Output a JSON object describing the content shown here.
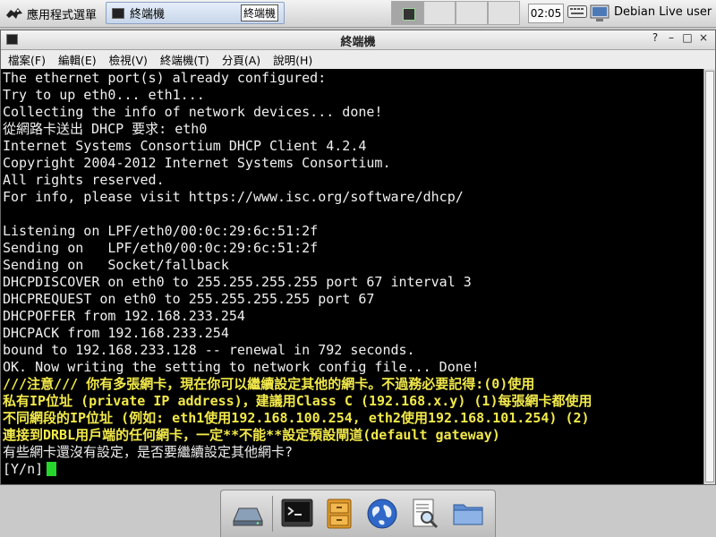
{
  "top_panel": {
    "app_menu_label": "應用程式選單",
    "task_title": "終端機",
    "task_title_right": "終端機",
    "clock": "02:05",
    "user": "Debian Live user"
  },
  "window": {
    "title": "終端機",
    "controls": {
      "help": "?",
      "minimize": "–",
      "maximize": "□",
      "close": "×"
    },
    "menu": [
      {
        "label": "檔案(F)"
      },
      {
        "label": "編輯(E)"
      },
      {
        "label": "檢視(V)"
      },
      {
        "label": "終端機(T)"
      },
      {
        "label": "分頁(A)"
      },
      {
        "label": "說明(H)"
      }
    ]
  },
  "terminal": {
    "lines": [
      {
        "text": "The ethernet port(s) already configured:",
        "style": "w"
      },
      {
        "text": "Try to up eth0... eth1...",
        "style": "w"
      },
      {
        "text": "Collecting the info of network devices... done!",
        "style": "w"
      },
      {
        "text": "從網路卡送出 DHCP 要求: eth0",
        "style": "w"
      },
      {
        "text": "Internet Systems Consortium DHCP Client 4.2.4",
        "style": "w"
      },
      {
        "text": "Copyright 2004-2012 Internet Systems Consortium.",
        "style": "w"
      },
      {
        "text": "All rights reserved.",
        "style": "w"
      },
      {
        "text": "For info, please visit https://www.isc.org/software/dhcp/",
        "style": "w"
      },
      {
        "text": "",
        "style": "w"
      },
      {
        "text": "Listening on LPF/eth0/00:0c:29:6c:51:2f",
        "style": "w"
      },
      {
        "text": "Sending on   LPF/eth0/00:0c:29:6c:51:2f",
        "style": "w"
      },
      {
        "text": "Sending on   Socket/fallback",
        "style": "w"
      },
      {
        "text": "DHCPDISCOVER on eth0 to 255.255.255.255 port 67 interval 3",
        "style": "w"
      },
      {
        "text": "DHCPREQUEST on eth0 to 255.255.255.255 port 67",
        "style": "w"
      },
      {
        "text": "DHCPOFFER from 192.168.233.254",
        "style": "w"
      },
      {
        "text": "DHCPACK from 192.168.233.254",
        "style": "w"
      },
      {
        "text": "bound to 192.168.233.128 -- renewal in 792 seconds.",
        "style": "w"
      },
      {
        "text": "OK. Now writing the setting to network config file... Done!",
        "style": "w"
      },
      {
        "text": "///注意/// 你有多張網卡，現在你可以繼續設定其他的網卡。不過務必要記得:(0)使用",
        "style": "y"
      },
      {
        "text": "私有IP位址 (private IP address)，建議用Class C (192.168.x.y) (1)每張網卡都使用",
        "style": "y"
      },
      {
        "text": "不同網段的IP位址 (例如: eth1使用192.168.100.254, eth2使用192.168.101.254) (2)",
        "style": "y"
      },
      {
        "text": "連接到DRBL用戶端的任何網卡，一定**不能**設定預設閘道(default gateway)",
        "style": "y"
      },
      {
        "text": "有些網卡還沒有設定，是否要繼續設定其他網卡?",
        "style": "w"
      }
    ],
    "prompt": "[Y/n]"
  },
  "dock": {
    "items": [
      {
        "icon": "network-drive-icon"
      },
      {
        "icon": "terminal-icon"
      },
      {
        "icon": "file-cabinet-icon"
      },
      {
        "icon": "web-browser-globe-icon"
      },
      {
        "icon": "document-search-icon"
      },
      {
        "icon": "folder-icon"
      }
    ]
  }
}
